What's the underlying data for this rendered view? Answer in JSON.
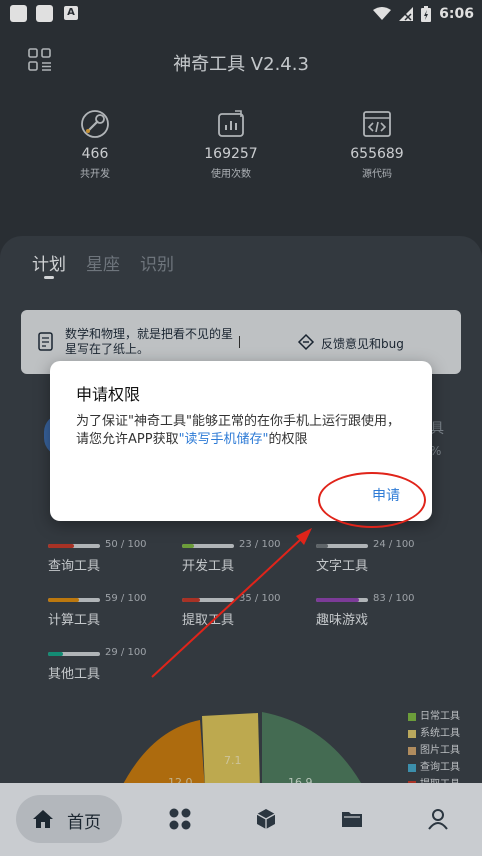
{
  "status": {
    "time": "6:06"
  },
  "header": {
    "title": "神奇工具 V2.4.3"
  },
  "stats": [
    {
      "value": "466",
      "label": "共开发",
      "icon": "wrench-icon"
    },
    {
      "value": "169257",
      "label": "使用次数",
      "icon": "chart-icon"
    },
    {
      "value": "655689",
      "label": "源代码",
      "icon": "code-window-icon"
    }
  ],
  "tabs": [
    {
      "label": "计划",
      "active": true
    },
    {
      "label": "星座"
    },
    {
      "label": "识别"
    }
  ],
  "notice": {
    "text": "数学和物理，就是把看不见的星星写在了纸上。",
    "separator": "|",
    "feedback": "反馈意见和bug"
  },
  "peek": {
    "right1": "具",
    "right2": "%"
  },
  "progress": [
    {
      "name": "查询工具",
      "value": "50 / 100",
      "fraction": 0.5,
      "color": "#c0392b"
    },
    {
      "name": "开发工具",
      "value": "23 / 100",
      "fraction": 0.23,
      "color": "#7cb342"
    },
    {
      "name": "文字工具",
      "value": "24 / 100",
      "fraction": 0.24,
      "color": "#6d7378"
    },
    {
      "name": "计算工具",
      "value": "59 / 100",
      "fraction": 0.59,
      "color": "#d68910"
    },
    {
      "name": "提取工具",
      "value": "35 / 100",
      "fraction": 0.35,
      "color": "#c0392b"
    },
    {
      "name": "趣味游戏",
      "value": "83 / 100",
      "fraction": 0.83,
      "color": "#8e44ad"
    },
    {
      "name": "其他工具",
      "value": "29 / 100",
      "fraction": 0.29,
      "color": "#16a085"
    }
  ],
  "pie": {
    "labels": [
      "12.0",
      "7.1",
      "16.9"
    ],
    "colors": [
      "#c57a10",
      "#d8c15a",
      "#4e7a5e"
    ]
  },
  "legend": [
    {
      "label": "日常工具",
      "color": "#7cb342"
    },
    {
      "label": "系统工具",
      "color": "#d4c06a"
    },
    {
      "label": "图片工具",
      "color": "#c9a06b"
    },
    {
      "label": "查询工具",
      "color": "#45a3c4"
    },
    {
      "label": "提取工具",
      "color": "#c0392b"
    }
  ],
  "dialog": {
    "title": "申请权限",
    "body_part1": "为了保证\"神奇工具\"能够正常的在你手机上运行跟使用，请您允许APP获取",
    "body_highlight": "\"读写手机储存\"",
    "body_part2": "的权限",
    "button": "申请"
  },
  "nav": {
    "home": "首页"
  }
}
